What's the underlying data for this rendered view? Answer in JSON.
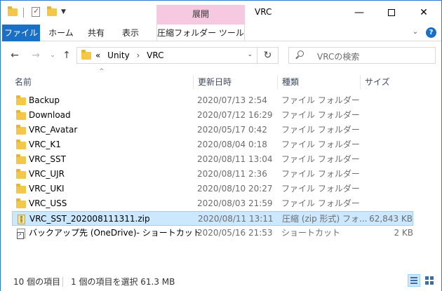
{
  "title_bar": {
    "contextual_tab_title": "展開",
    "window_title": "VRC"
  },
  "ribbon": {
    "tabs": [
      "ファイル",
      "ホーム",
      "共有",
      "表示",
      "圧縮フォルダー ツール"
    ]
  },
  "navigation": {
    "breadcrumb": [
      "«",
      "Unity",
      "VRC"
    ],
    "search_placeholder": "VRCの検索"
  },
  "columns": {
    "name": "名前",
    "date": "更新日時",
    "type": "種類",
    "size": "サイズ"
  },
  "files": [
    {
      "name": "Backup",
      "date": "2020/07/13 2:54",
      "type": "ファイル フォルダー",
      "size": "",
      "icon": "folder"
    },
    {
      "name": "Download",
      "date": "2020/07/12 16:29",
      "type": "ファイル フォルダー",
      "size": "",
      "icon": "folder"
    },
    {
      "name": "VRC_Avatar",
      "date": "2020/05/17 0:42",
      "type": "ファイル フォルダー",
      "size": "",
      "icon": "folder"
    },
    {
      "name": "VRC_K1",
      "date": "2020/08/04 0:18",
      "type": "ファイル フォルダー",
      "size": "",
      "icon": "folder"
    },
    {
      "name": "VRC_SST",
      "date": "2020/08/11 13:04",
      "type": "ファイル フォルダー",
      "size": "",
      "icon": "folder"
    },
    {
      "name": "VRC_UJR",
      "date": "2020/08/11 2:36",
      "type": "ファイル フォルダー",
      "size": "",
      "icon": "folder"
    },
    {
      "name": "VRC_UKI",
      "date": "2020/08/10 20:27",
      "type": "ファイル フォルダー",
      "size": "",
      "icon": "folder"
    },
    {
      "name": "VRC_USS",
      "date": "2020/08/03 21:59",
      "type": "ファイル フォルダー",
      "size": "",
      "icon": "folder"
    },
    {
      "name": "VRC_SST_202008111311.zip",
      "date": "2020/08/11 13:11",
      "type": "圧縮 (zip 形式) フォ...",
      "size": "62,843 KB",
      "icon": "zip",
      "selected": true
    },
    {
      "name": "バックアップ先 (OneDrive)- ショートカット",
      "date": "2020/05/16 21:53",
      "type": "ショートカット",
      "size": "2 KB",
      "icon": "shortcut"
    }
  ],
  "status": {
    "item_count": "10 個の項目",
    "selection": "1 個の項目を選択  61.3 MB"
  },
  "colors": {
    "accent": "#1a6fc7",
    "contextual_tab": "#f7c9e0",
    "selection_bg": "#cce8ff",
    "selection_border": "#99d1ff"
  }
}
